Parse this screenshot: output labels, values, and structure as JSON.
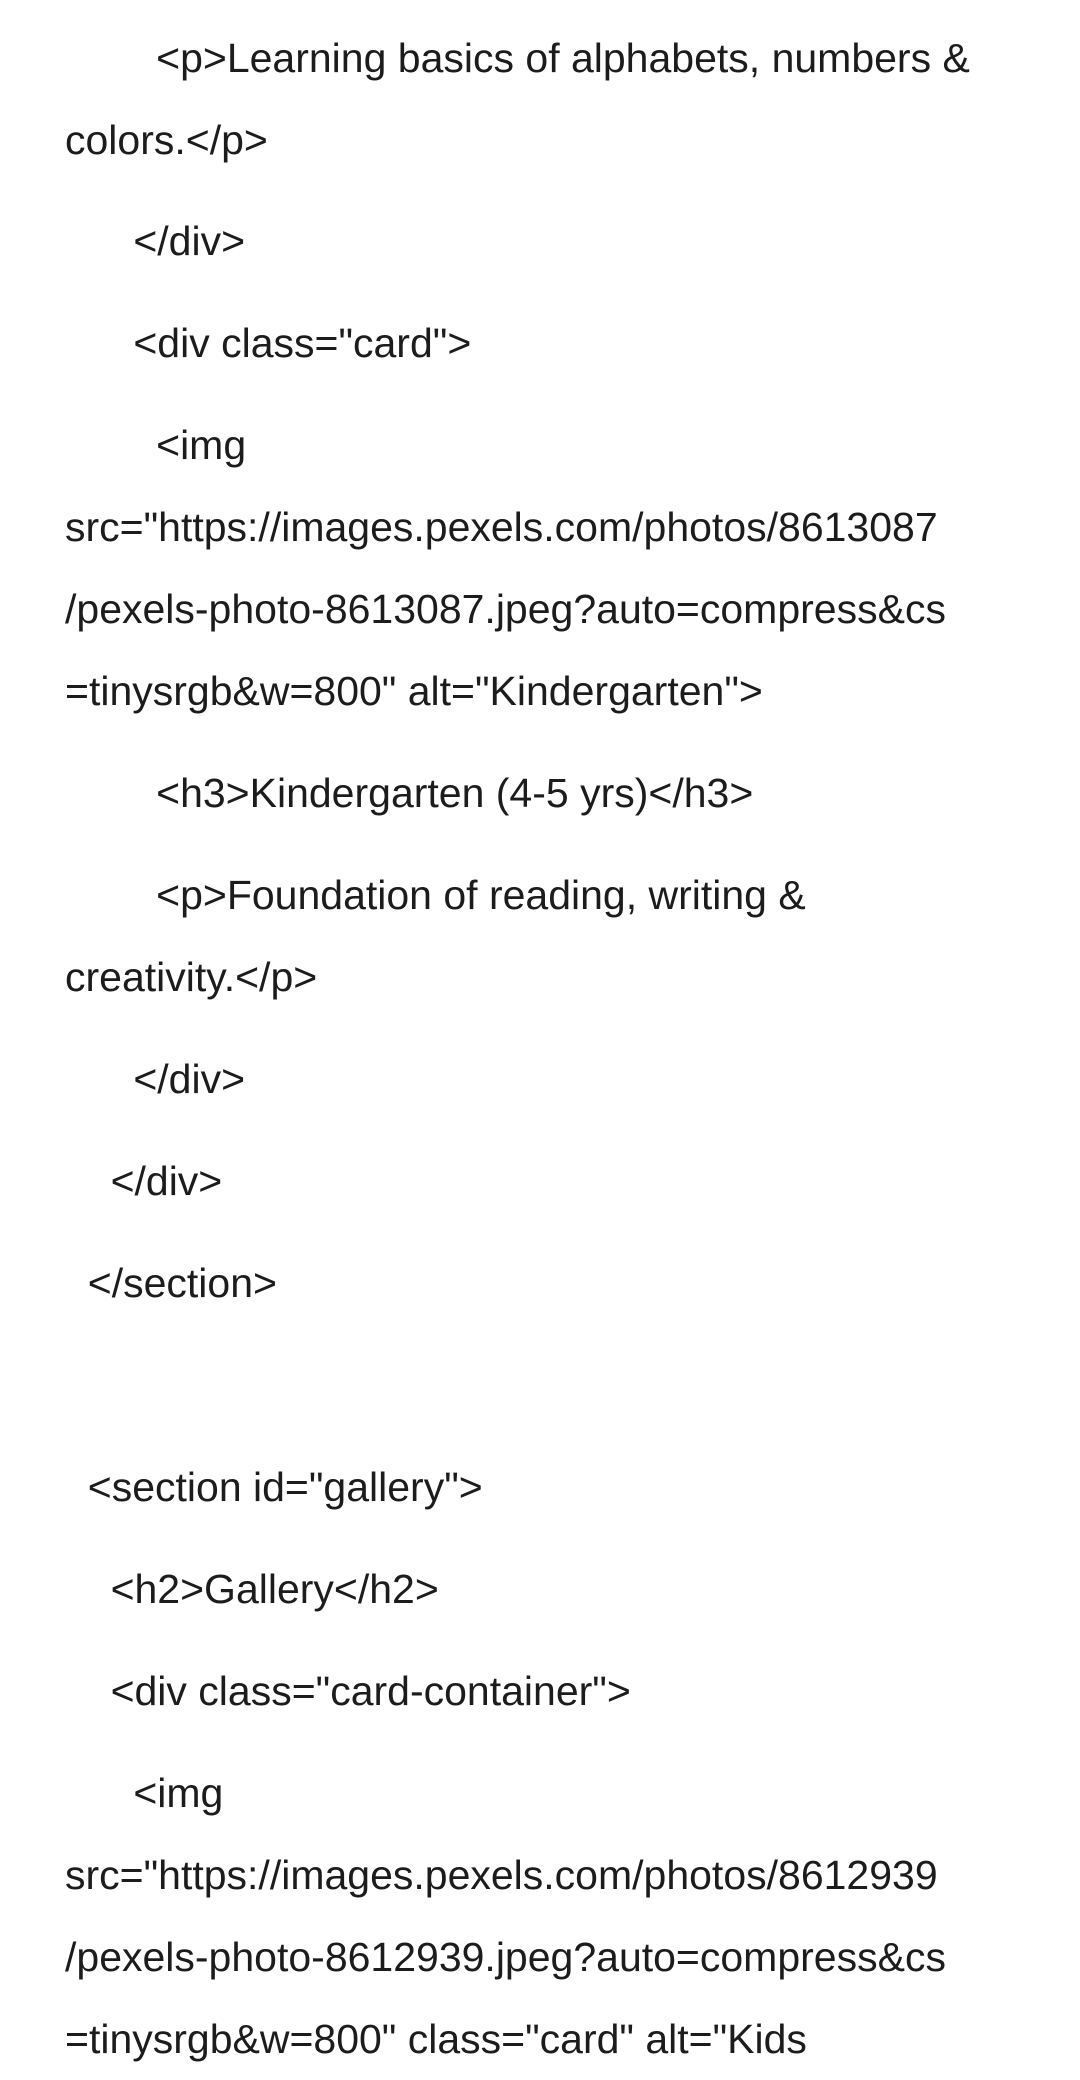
{
  "document": {
    "lines": [
      "        <p>Learning basics of alphabets, numbers &",
      "colors.</p>",
      "      </div>",
      "      <div class=\"card\">",
      "        <img",
      "src=\"https://images.pexels.com/photos/8613087",
      "/pexels-photo-8613087.jpeg?auto=compress&cs",
      "=tinysrgb&w=800\" alt=\"Kindergarten\">",
      "        <h3>Kindergarten (4-5 yrs)</h3>",
      "        <p>Foundation of reading, writing &",
      "creativity.</p>",
      "      </div>",
      "    </div>",
      "  </section>",
      "",
      "  <section id=\"gallery\">",
      "    <h2>Gallery</h2>",
      "    <div class=\"card-container\">",
      "      <img",
      "src=\"https://images.pexels.com/photos/8612939",
      "/pexels-photo-8612939.jpeg?auto=compress&cs",
      "=tinysrgb&w=800\" class=\"card\" alt=\"Kids"
    ]
  }
}
